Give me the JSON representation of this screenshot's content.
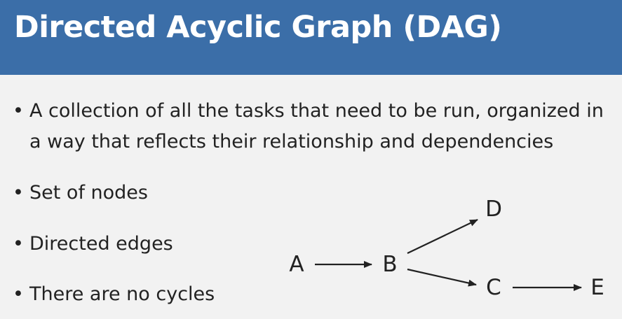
{
  "title": "Directed Acyclic Graph (DAG)",
  "bullets": [
    "A collection of all the tasks that need to be run, organized in a way that reflects their relationship and dependencies",
    "Set of nodes",
    "Directed edges",
    "There are no cycles"
  ],
  "graph": {
    "nodes": [
      "A",
      "B",
      "C",
      "D",
      "E"
    ],
    "edges": [
      [
        "A",
        "B"
      ],
      [
        "B",
        "D"
      ],
      [
        "B",
        "C"
      ],
      [
        "C",
        "E"
      ]
    ]
  },
  "colors": {
    "title_bar": "#3b6ea8",
    "title_text": "#ffffff",
    "background": "#f2f2f2",
    "text": "#222222"
  }
}
